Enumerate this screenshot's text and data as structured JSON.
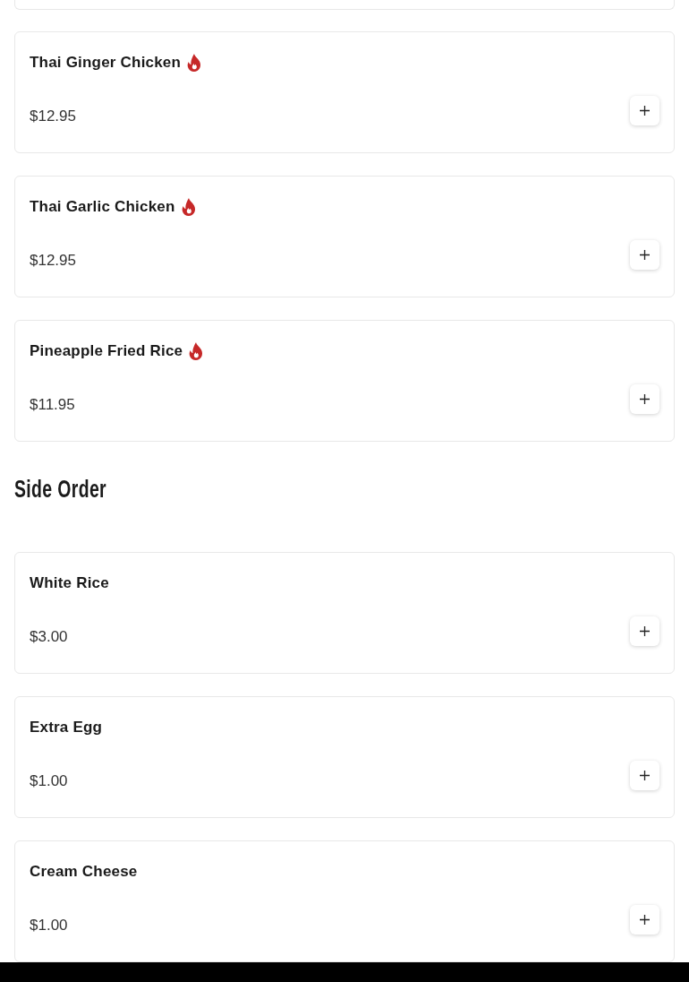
{
  "sections": [
    {
      "items": [
        {
          "name": "Thai Ginger Chicken",
          "spicy": true,
          "price": "$12.95"
        },
        {
          "name": "Thai Garlic Chicken",
          "spicy": true,
          "price": "$12.95"
        },
        {
          "name": "Pineapple Fried Rice",
          "spicy": true,
          "price": "$11.95"
        }
      ]
    },
    {
      "title": "Side Order",
      "items": [
        {
          "name": "White Rice",
          "spicy": false,
          "price": "$3.00"
        },
        {
          "name": "Extra Egg",
          "spicy": false,
          "price": "$1.00"
        },
        {
          "name": "Cream Cheese",
          "spicy": false,
          "price": "$1.00"
        }
      ]
    }
  ]
}
